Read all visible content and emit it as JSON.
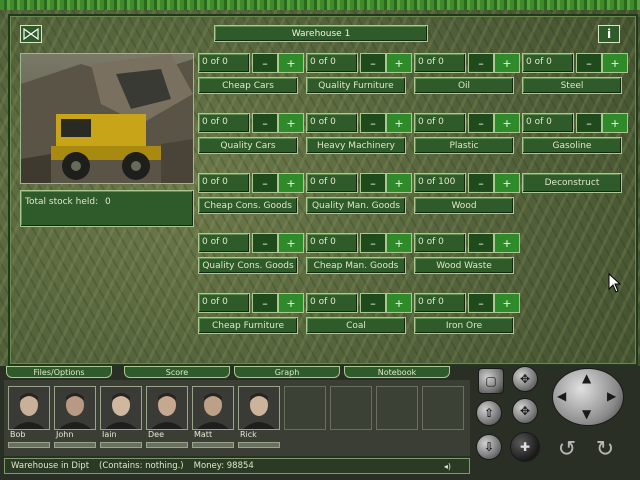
{
  "window": {
    "title": "Warehouse 1",
    "info_label": "i"
  },
  "stock": {
    "label": "Total stock held:",
    "value": "0"
  },
  "items": [
    {
      "count": "0 of 0",
      "name": "Cheap Cars"
    },
    {
      "count": "0 of 0",
      "name": "Quality Furniture"
    },
    {
      "count": "0 of 0",
      "name": "Oil"
    },
    {
      "count": "0 of 0",
      "name": "Steel"
    },
    {
      "count": "0 of 0",
      "name": "Quality Cars"
    },
    {
      "count": "0 of 0",
      "name": "Heavy Machinery"
    },
    {
      "count": "0 of 0",
      "name": "Plastic"
    },
    {
      "count": "0 of 0",
      "name": "Gasoline"
    },
    {
      "count": "0 of 0",
      "name": "Cheap Cons. Goods"
    },
    {
      "count": "0 of 0",
      "name": "Quality Man. Goods"
    },
    {
      "count": "0 of 100",
      "name": "Wood"
    },
    {
      "count": "0 of 0",
      "name": "Quality Cons. Goods"
    },
    {
      "count": "0 of 0",
      "name": "Cheap Man. Goods"
    },
    {
      "count": "0 of 0",
      "name": "Wood Waste"
    },
    {
      "count": "0 of 0",
      "name": "Cheap Furniture"
    },
    {
      "count": "0 of 0",
      "name": "Coal"
    },
    {
      "count": "0 of 0",
      "name": "Iron Ore"
    }
  ],
  "button_labels": {
    "minus": "–",
    "plus": "+",
    "deconstruct": "Deconstruct"
  },
  "tabs": [
    "Files/Options",
    "Score",
    "Graph",
    "Notebook"
  ],
  "people": [
    "Bob",
    "John",
    "Iain",
    "Dee",
    "Matt",
    "Rick"
  ],
  "status": {
    "location": "Warehouse in Dipt",
    "contents": "(Contains:  nothing.)",
    "money": "Money: 98854",
    "sound_glyph": "◂)"
  },
  "colors": {
    "panel_green": "#2f5a2a",
    "plus_green": "#2f8a2a",
    "text_light": "#dfe8c8"
  }
}
